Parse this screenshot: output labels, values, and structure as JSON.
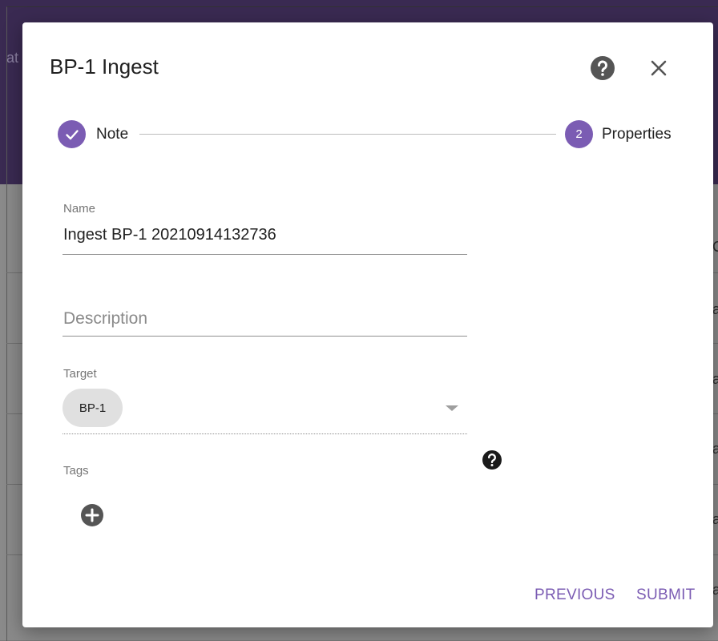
{
  "dialog": {
    "title": "BP-1 Ingest"
  },
  "stepper": {
    "steps": [
      {
        "label": "Note",
        "state": "completed",
        "number": ""
      },
      {
        "label": "Properties",
        "state": "active",
        "number": "2"
      }
    ]
  },
  "form": {
    "name": {
      "label": "Name",
      "value": "Ingest BP-1 20210914132736"
    },
    "description": {
      "placeholder": "Description",
      "value": ""
    },
    "target": {
      "label": "Target",
      "chip": "BP-1"
    },
    "tags": {
      "label": "Tags"
    }
  },
  "actions": {
    "previous": "PREVIOUS",
    "submit": "SUBMIT"
  },
  "background": {
    "fragments": [
      "at",
      "C",
      "a",
      "a",
      "a",
      "a",
      "a"
    ]
  },
  "colors": {
    "accent": "#7b5cb3",
    "header_bg": "#3a2a52",
    "chip_bg": "#e0e0e0",
    "text": "#212121",
    "muted": "#757575"
  }
}
